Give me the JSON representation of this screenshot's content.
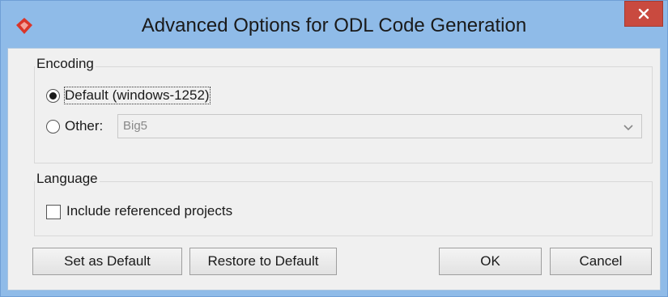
{
  "window": {
    "title": "Advanced Options for ODL Code Generation",
    "close_label": "×"
  },
  "encoding": {
    "group_label": "Encoding",
    "default_option": "Default (windows-1252)",
    "default_selected": true,
    "other_label": "Other:",
    "other_selected": false,
    "other_value": "Big5"
  },
  "language": {
    "group_label": "Language",
    "include_referenced_label": "Include referenced projects",
    "include_referenced_checked": false
  },
  "buttons": {
    "set_default": "Set as Default",
    "restore_default": "Restore to Default",
    "ok": "OK",
    "cancel": "Cancel"
  },
  "colors": {
    "titlebar": "#8fbbe8",
    "close_button": "#c94a3f",
    "dialog_background": "#f0f0f0",
    "app_icon": "#d9352a"
  },
  "icons": {
    "app": "app-logo-icon",
    "close": "close-icon",
    "dropdown": "chevron-down-icon"
  }
}
